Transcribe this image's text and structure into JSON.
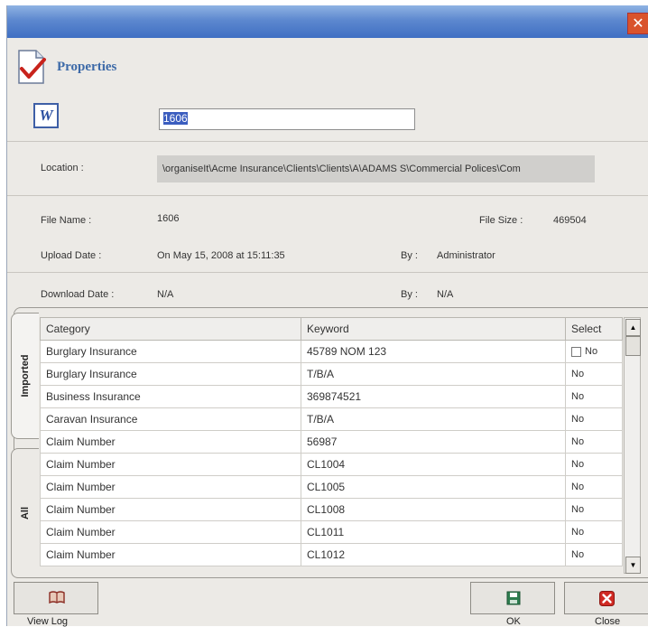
{
  "window": {
    "close_glyph": "✕"
  },
  "header": {
    "title": "Properties",
    "icon": "properties-checkmark-icon"
  },
  "document": {
    "icon": "word-document-icon",
    "icon_letter": "W",
    "name_value": "1606"
  },
  "location": {
    "label": "Location :",
    "value": "\\organiseIt\\Acme Insurance\\Clients\\Clients\\A\\ADAMS S\\Commercial Polices\\Com"
  },
  "file": {
    "name_label": "File Name :",
    "name_value": "1606",
    "size_label": "File Size :",
    "size_value": "469504",
    "upload_label": "Upload Date :",
    "upload_value": "On May 15, 2008 at 15:11:35",
    "upload_by_label": "By :",
    "upload_by_value": "Administrator",
    "download_label": "Download Date :",
    "download_value": "N/A",
    "download_by_label": "By :",
    "download_by_value": "N/A"
  },
  "tabs": {
    "imported": "Imported",
    "all": "All"
  },
  "grid": {
    "headers": {
      "category": "Category",
      "keyword": "Keyword",
      "select": "Select"
    },
    "rows": [
      {
        "category": "Burglary Insurance",
        "keyword": "45789 NOM 123",
        "select": "No"
      },
      {
        "category": "Burglary Insurance",
        "keyword": "T/B/A",
        "select": "No"
      },
      {
        "category": "Business Insurance",
        "keyword": "369874521",
        "select": "No"
      },
      {
        "category": "Caravan Insurance",
        "keyword": "T/B/A",
        "select": "No"
      },
      {
        "category": "Claim Number",
        "keyword": "56987",
        "select": "No"
      },
      {
        "category": "Claim Number",
        "keyword": "CL1004",
        "select": "No"
      },
      {
        "category": "Claim Number",
        "keyword": "CL1005",
        "select": "No"
      },
      {
        "category": "Claim Number",
        "keyword": "CL1008",
        "select": "No"
      },
      {
        "category": "Claim Number",
        "keyword": "CL1011",
        "select": "No"
      },
      {
        "category": "Claim Number",
        "keyword": "CL1012",
        "select": "No"
      }
    ]
  },
  "scrollbar": {
    "up_glyph": "▲",
    "down_glyph": "▼"
  },
  "buttons": {
    "view_log": {
      "label": "View Log",
      "icon": "book-icon"
    },
    "ok": {
      "label": "OK",
      "icon": "save-disk-icon"
    },
    "close": {
      "label": "Close",
      "icon": "close-icon"
    }
  },
  "colors": {
    "titlebar": "#5d88cf",
    "header_title": "#3d6aa8",
    "close_red": "#d9532c",
    "ok_icon": "#2e7d4f"
  }
}
